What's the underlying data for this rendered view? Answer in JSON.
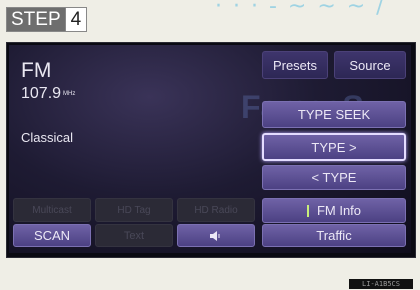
{
  "step": {
    "label": "STEP",
    "number": "4"
  },
  "radio": {
    "band": "FM",
    "frequency": "107.9",
    "frequency_unit": "MHz",
    "genre": "Classical"
  },
  "watermark": "FamasS",
  "buttons": {
    "presets": "Presets",
    "source": "Source",
    "type_seek": "TYPE SEEK",
    "type_next": "TYPE >",
    "type_prev": "< TYPE",
    "fm_info": "FM Info",
    "traffic": "Traffic",
    "scan": "SCAN",
    "multicast": "Multicast",
    "hd_tag": "HD Tag",
    "hd_radio": "HD Radio",
    "text": "Text"
  },
  "icons": {
    "sound": "speaker-icon",
    "fm_indicator": "indicator-bar"
  },
  "colors": {
    "button": "#5c4f96",
    "selected_border": "#e4dcff",
    "screen_bg": "#1e1b33",
    "indicator": "#c8ef7a"
  },
  "caption": "LI-A1B5CS"
}
